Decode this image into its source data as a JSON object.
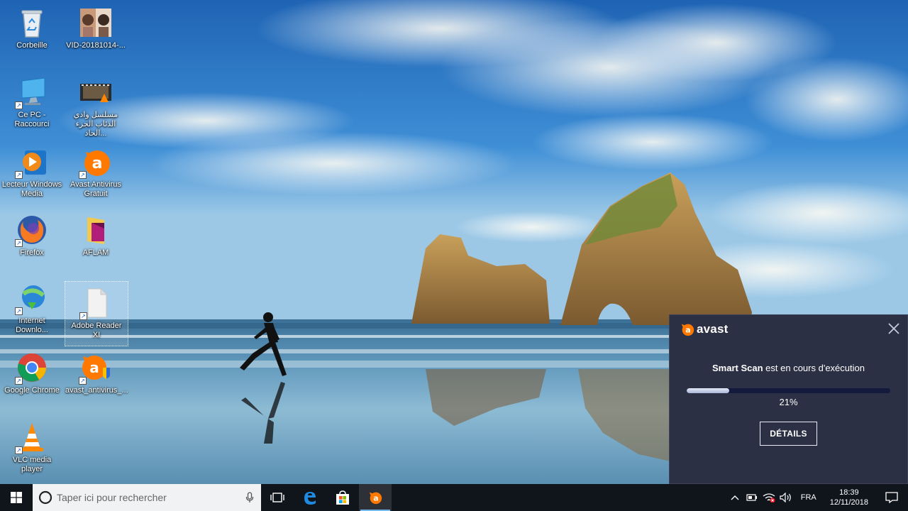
{
  "desktop": {
    "icons": [
      {
        "label": "Corbeille"
      },
      {
        "label": "VID-20181014-..."
      },
      {
        "label": "Ce PC - Raccourci"
      },
      {
        "label": "مسلسل وادي الذئاب الجزء الحاد..."
      },
      {
        "label": "Lecteur Windows Media"
      },
      {
        "label": "Avast Antivirus Gratuit"
      },
      {
        "label": "Firefox"
      },
      {
        "label": "AFLAM"
      },
      {
        "label": "Internet Downlo..."
      },
      {
        "label": "Adobe Reader XI"
      },
      {
        "label": "Google Chrome"
      },
      {
        "label": "avast_antivirus_..."
      },
      {
        "label": "VLC media player"
      }
    ]
  },
  "avast_popup": {
    "brand": "avast",
    "status_bold": "Smart Scan",
    "status_rest": " est en cours d'exécution",
    "progress_fraction": 0.21,
    "progress_label": "21%",
    "details_label": "DÉTAILS",
    "colors": {
      "background": "#2b3044",
      "accent": "#ff7800",
      "track": "#141a3b"
    }
  },
  "taskbar": {
    "search_placeholder": "Taper ici pour rechercher",
    "language": "FRA",
    "time": "18:39",
    "date": "12/11/2018",
    "colors": {
      "background": "#10141b",
      "active_indicator": "#76b9ed"
    }
  }
}
